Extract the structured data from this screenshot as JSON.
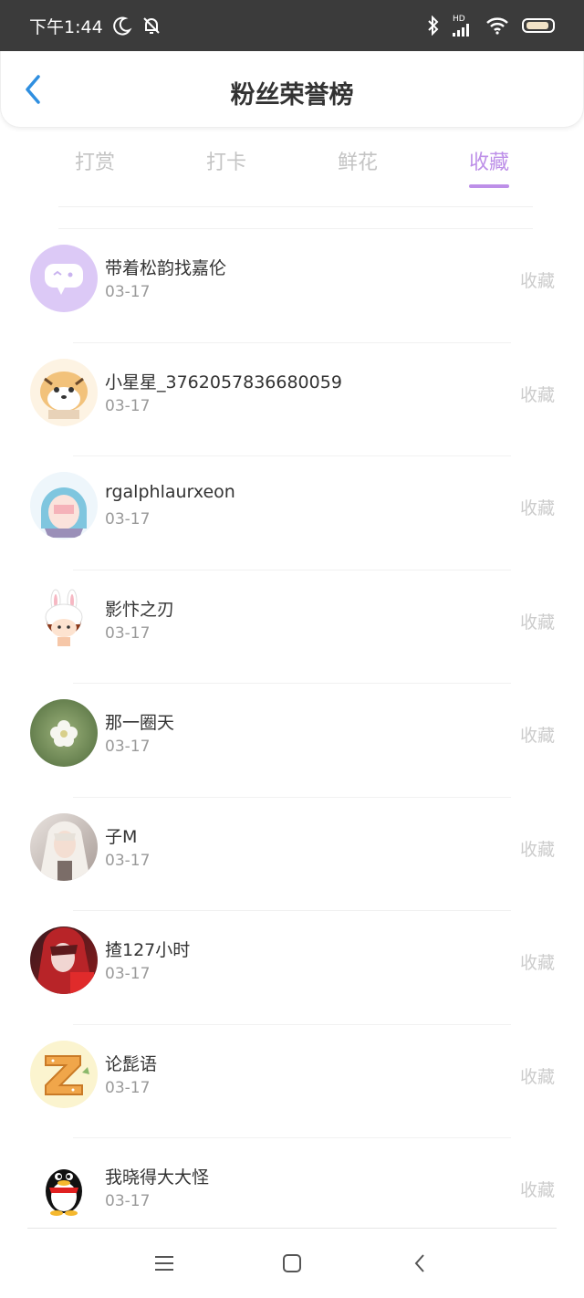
{
  "status_bar": {
    "time": "下午1:44",
    "network": "HD"
  },
  "header": {
    "title": "粉丝荣誉榜"
  },
  "tabs": [
    {
      "label": "打赏",
      "active": false
    },
    {
      "label": "打卡",
      "active": false
    },
    {
      "label": "鲜花",
      "active": false
    },
    {
      "label": "收藏",
      "active": true
    }
  ],
  "colors": {
    "accent": "#bd8fe8",
    "back_arrow": "#2f8fe0",
    "status_bar_bg": "#3b3b3b"
  },
  "fans": [
    {
      "name": "带着松韵找嘉伦",
      "date": "03-17",
      "action": "收藏",
      "avatar": "chat-bubble-avatar"
    },
    {
      "name": "小星星_3762057836680059",
      "date": "03-17",
      "action": "收藏",
      "avatar": "tiger-avatar"
    },
    {
      "name": "rgalphlaurxeon",
      "date": "03-17",
      "action": "收藏",
      "avatar": "anime-girl-avatar"
    },
    {
      "name": "影忭之刃",
      "date": "03-17",
      "action": "收藏",
      "avatar": "bunny-girl-avatar"
    },
    {
      "name": "那一圈天",
      "date": "03-17",
      "action": "收藏",
      "avatar": "flower-avatar"
    },
    {
      "name": "子M",
      "date": "03-17",
      "action": "收藏",
      "avatar": "white-hair-avatar"
    },
    {
      "name": "揸127小时",
      "date": "03-17",
      "action": "收藏",
      "avatar": "red-hair-avatar"
    },
    {
      "name": "论髭语",
      "date": "03-17",
      "action": "收藏",
      "avatar": "letter-z-avatar"
    },
    {
      "name": "我晓得大大怪",
      "date": "03-17",
      "action": "收藏",
      "avatar": "penguin-avatar"
    }
  ]
}
